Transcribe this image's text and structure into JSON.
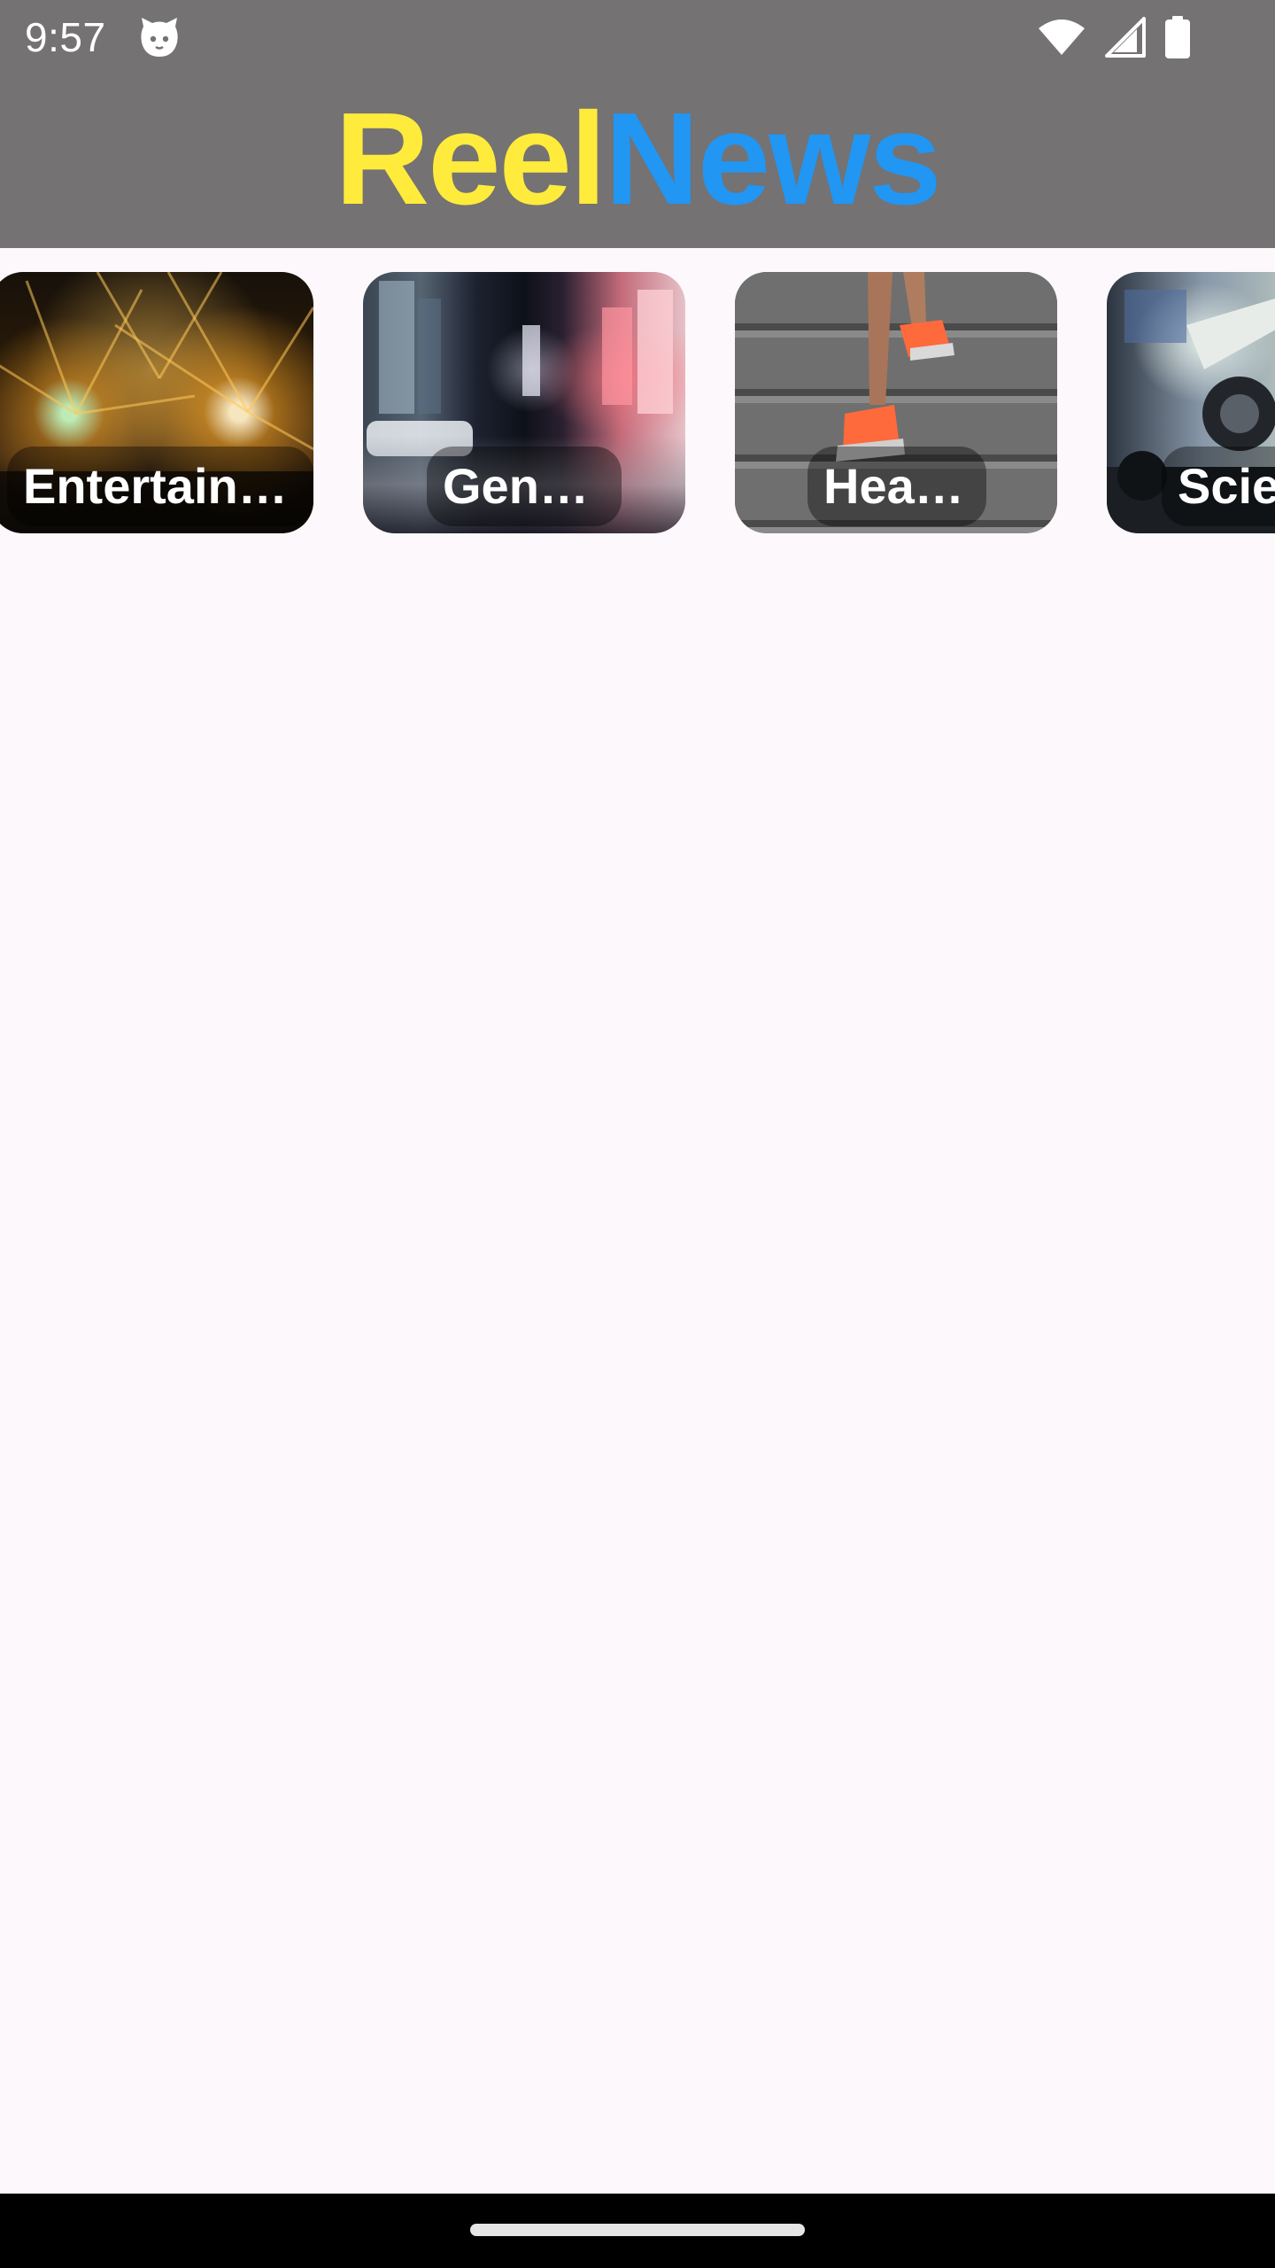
{
  "status_bar": {
    "time": "9:57",
    "icons": [
      "cat-notification-icon",
      "wifi-icon",
      "cellular-signal-icon",
      "battery-icon"
    ]
  },
  "app_bar": {
    "title_part1": "Reel",
    "title_part2": "News",
    "colors": {
      "background": "#747273",
      "reel": "#ffeb3b",
      "news": "#2196f3"
    }
  },
  "categories": [
    {
      "label": "Entertainm…"
    },
    {
      "label": "General"
    },
    {
      "label": "Health"
    },
    {
      "label": "Scie"
    }
  ],
  "navigation_bar": {
    "icons": [
      "gesture-handle"
    ]
  }
}
